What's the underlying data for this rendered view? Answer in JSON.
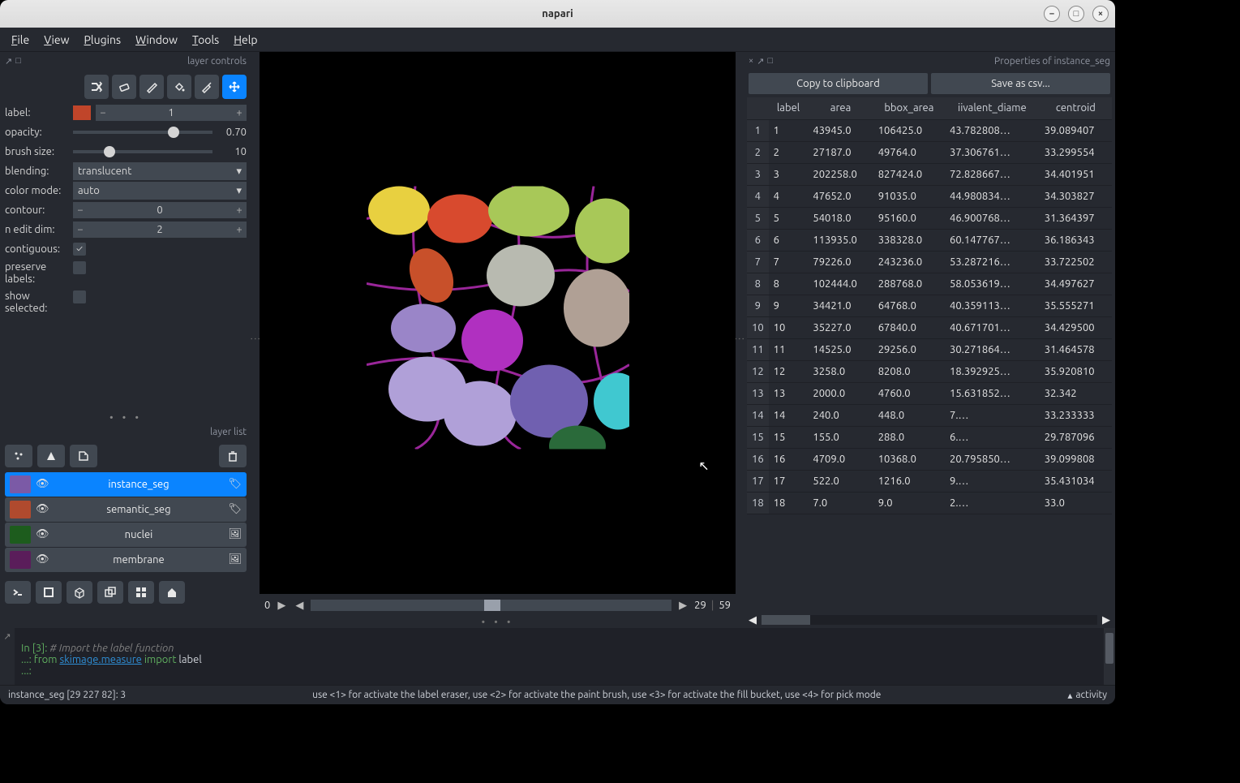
{
  "title": "napari",
  "menu": [
    "File",
    "View",
    "Plugins",
    "Window",
    "Tools",
    "Help"
  ],
  "panels": {
    "layer_controls_title": "layer controls",
    "layer_list_title": "layer list",
    "properties_title": "Properties of instance_seg"
  },
  "tools": {
    "shuffle": "shuffle-colors",
    "erase": "eraser",
    "paint": "paint-brush",
    "fill": "fill-bucket",
    "pick": "color-picker",
    "pan": "pan-zoom"
  },
  "controls": {
    "label_label": "label:",
    "label_value": "1",
    "opacity_label": "opacity:",
    "opacity_value": "0.70",
    "brush_label": "brush size:",
    "brush_value": "10",
    "blending_label": "blending:",
    "blending_value": "translucent",
    "colormode_label": "color mode:",
    "colormode_value": "auto",
    "contour_label": "contour:",
    "contour_value": "0",
    "nedit_label": "n edit dim:",
    "nedit_value": "2",
    "contiguous_label": "contiguous:",
    "contiguous_checked": true,
    "preserve_label": "preserve labels:",
    "preserve_checked": false,
    "showsel_label": "show selected:",
    "showsel_checked": false
  },
  "layers": [
    {
      "name": "instance_seg",
      "selected": true,
      "type": "labels",
      "thumb": "#7b5aa6"
    },
    {
      "name": "semantic_seg",
      "selected": false,
      "type": "labels",
      "thumb": "#b04a2e"
    },
    {
      "name": "nuclei",
      "selected": false,
      "type": "image",
      "thumb": "#1d5c1d"
    },
    {
      "name": "membrane",
      "selected": false,
      "type": "image",
      "thumb": "#5a1d5a"
    }
  ],
  "timeline": {
    "value": "0",
    "frame": "29",
    "total": "59"
  },
  "properties": {
    "copy_btn": "Copy to clipboard",
    "save_btn": "Save as csv...",
    "columns": [
      "",
      "label",
      "area",
      "bbox_area",
      "iivalent_diame",
      "centroid"
    ],
    "rows": [
      [
        "1",
        "1",
        "43945.0",
        "106425.0",
        "43.782808…",
        "39.089407"
      ],
      [
        "2",
        "2",
        "27187.0",
        "49764.0",
        "37.306761…",
        "33.299554"
      ],
      [
        "3",
        "3",
        "202258.0",
        "827424.0",
        "72.828667…",
        "34.401951"
      ],
      [
        "4",
        "4",
        "47652.0",
        "91035.0",
        "44.980834…",
        "34.303827"
      ],
      [
        "5",
        "5",
        "54018.0",
        "95160.0",
        "46.900768…",
        "31.364397"
      ],
      [
        "6",
        "6",
        "113935.0",
        "338328.0",
        "60.147767…",
        "36.186343"
      ],
      [
        "7",
        "7",
        "79226.0",
        "243236.0",
        "53.287216…",
        "33.722502"
      ],
      [
        "8",
        "8",
        "102444.0",
        "288768.0",
        "58.053619…",
        "34.497627"
      ],
      [
        "9",
        "9",
        "34421.0",
        "64768.0",
        "40.359113…",
        "35.555271"
      ],
      [
        "10",
        "10",
        "35227.0",
        "67840.0",
        "40.671701…",
        "34.429500"
      ],
      [
        "11",
        "11",
        "14525.0",
        "29256.0",
        "30.271864…",
        "31.464578"
      ],
      [
        "12",
        "12",
        "3258.0",
        "8208.0",
        "18.392925…",
        "35.920810"
      ],
      [
        "13",
        "13",
        "2000.0",
        "4760.0",
        "15.631852…",
        "32.342"
      ],
      [
        "14",
        "14",
        "240.0",
        "448.0",
        "7.…",
        "33.233333"
      ],
      [
        "15",
        "15",
        "155.0",
        "288.0",
        "6.…",
        "29.787096"
      ],
      [
        "16",
        "16",
        "4709.0",
        "10368.0",
        "20.795850…",
        "39.099808"
      ],
      [
        "17",
        "17",
        "522.0",
        "1216.0",
        "9.…",
        "35.431034"
      ],
      [
        "18",
        "18",
        "7.0",
        "9.0",
        "2.…",
        "33.0"
      ]
    ]
  },
  "console": {
    "prompt": "In [3]:",
    "cont": "   ...:",
    "comment": "# Import the label function",
    "kw_from": "from",
    "module": "skimage.measure",
    "kw_import": "import",
    "ident": "label"
  },
  "status": {
    "left": "instance_seg [29 227 82]: 3",
    "mid": "use <1> for activate the label eraser, use <2> for activate the paint brush, use <3> for activate the fill bucket, use <4> for pick mode",
    "right": "activity"
  }
}
